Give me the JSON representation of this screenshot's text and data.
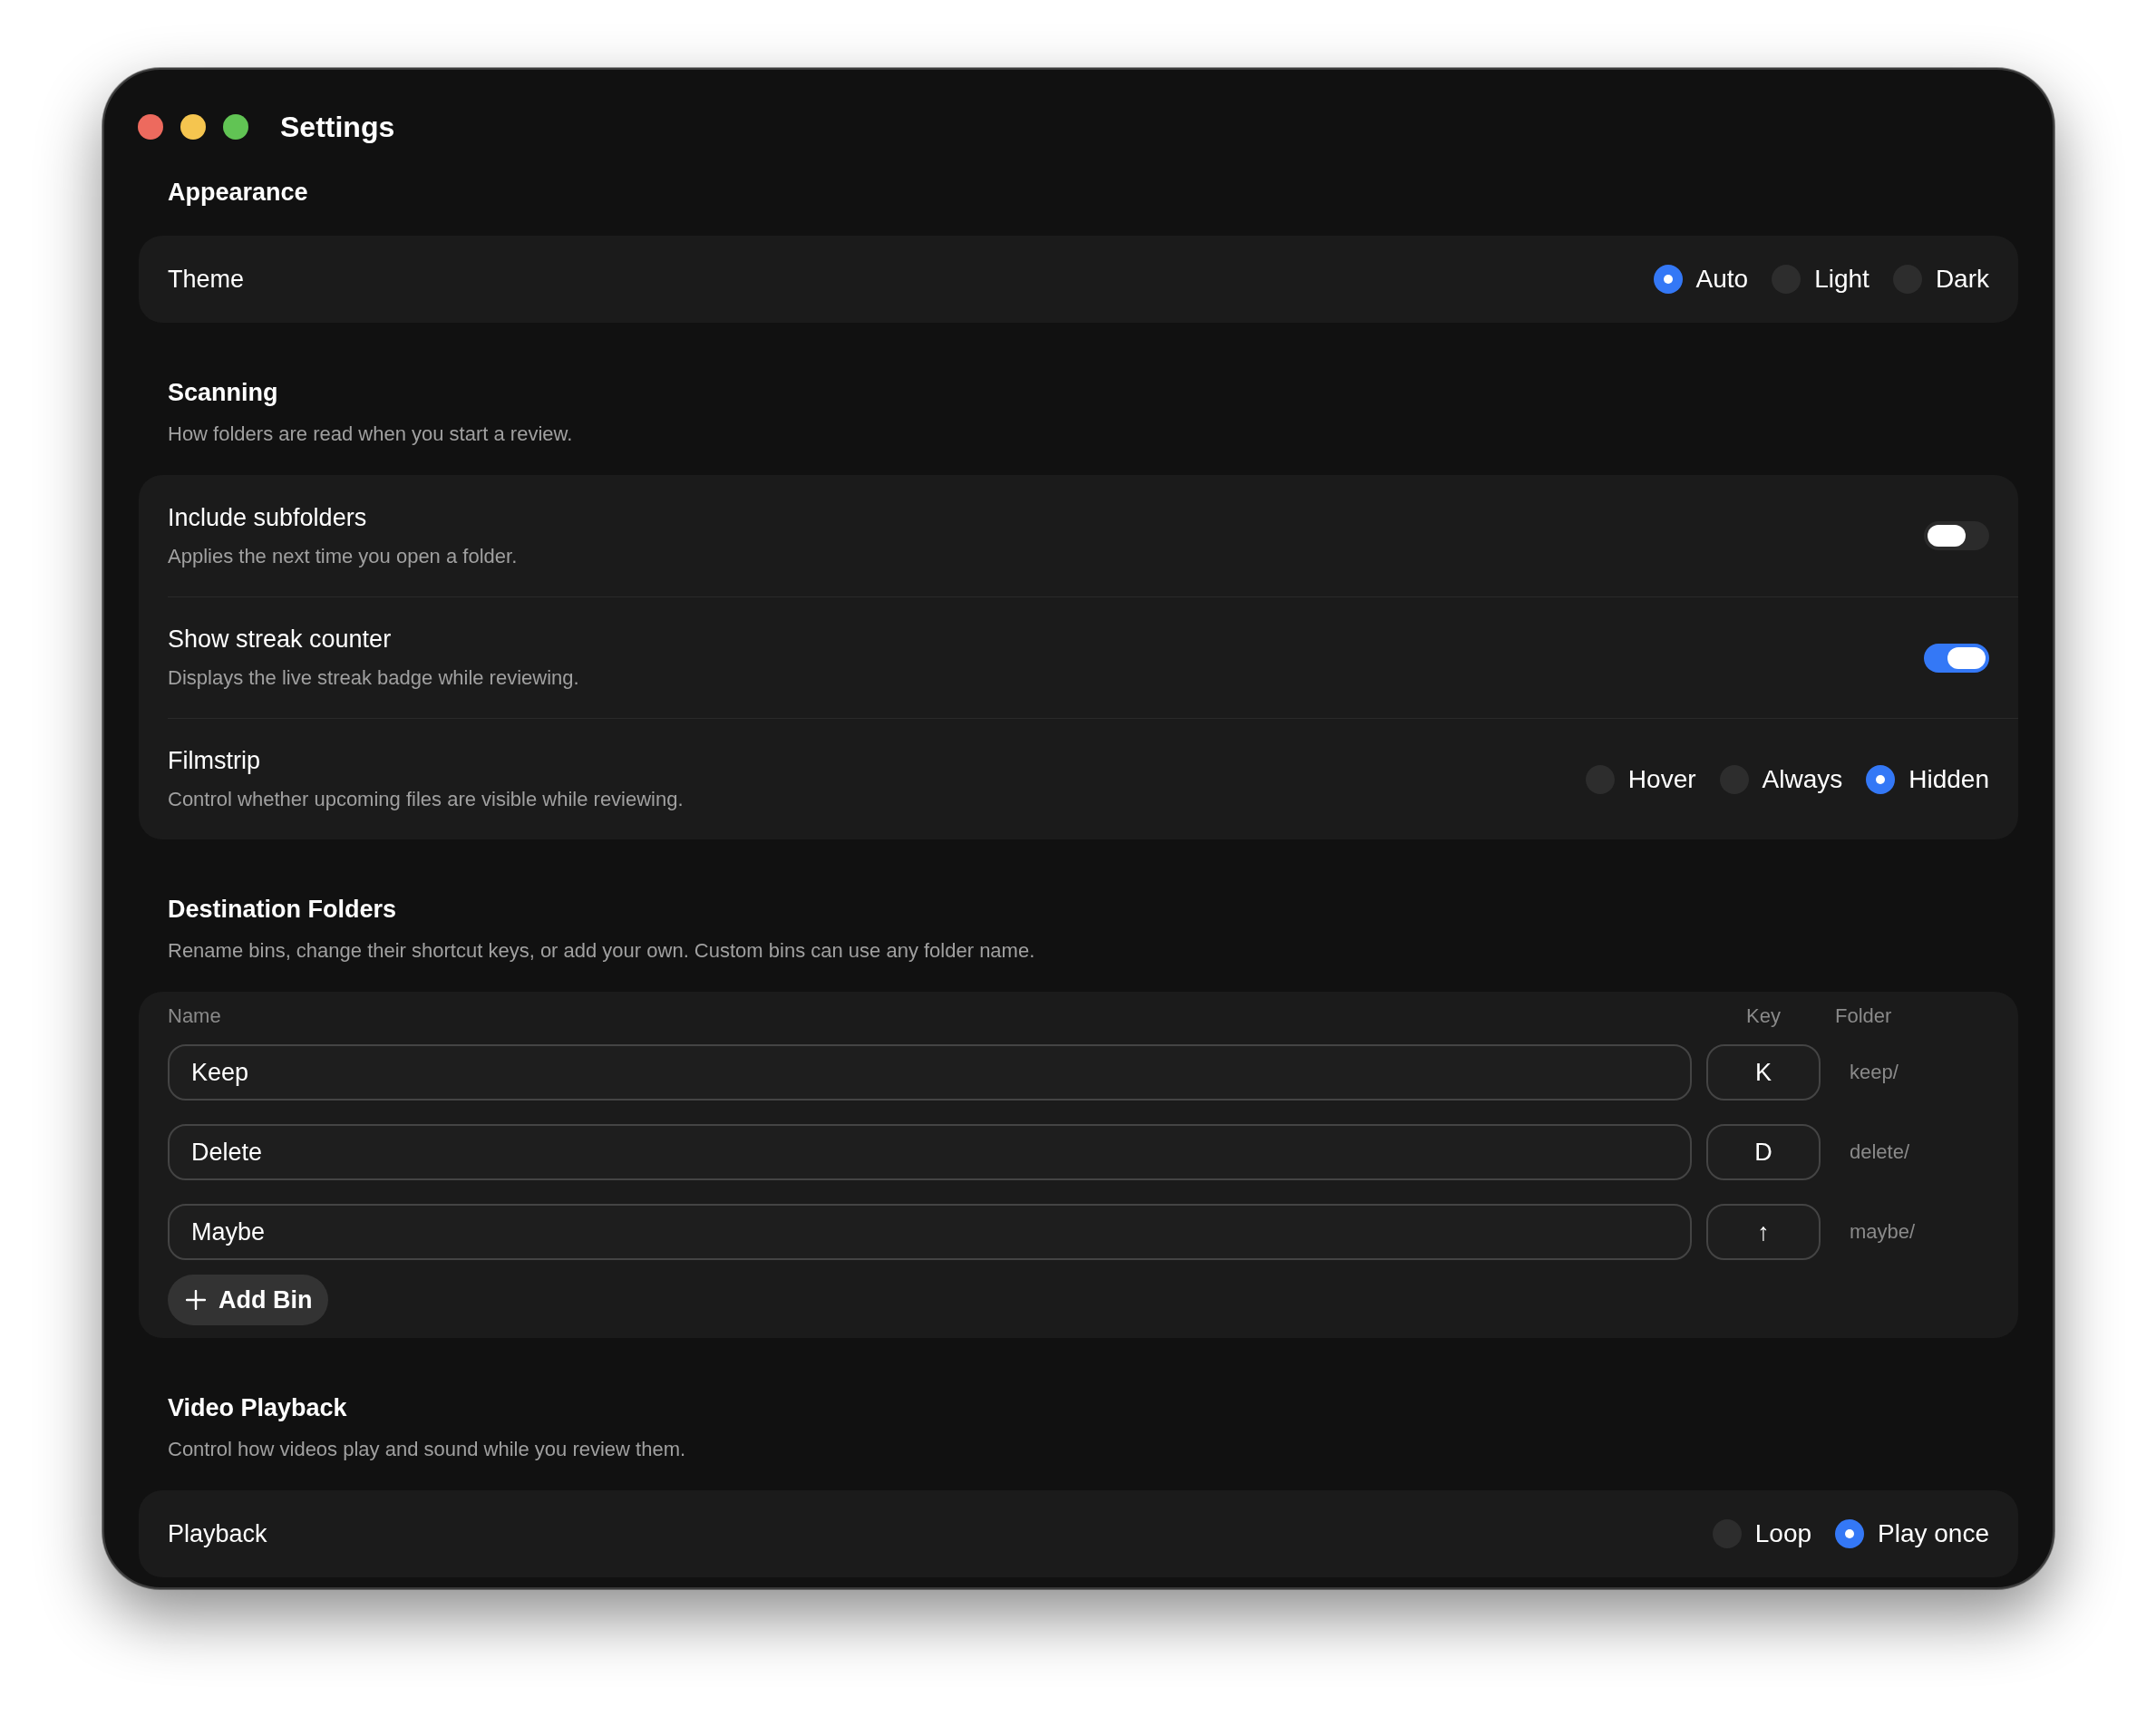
{
  "window": {
    "title": "Settings"
  },
  "sections": [
    {
      "heading": "Appearance",
      "card": {
        "kind": "rows",
        "rows": [
          {
            "kind": "radio",
            "label": "Theme",
            "options": [
              {
                "label": "Auto",
                "selected": true
              },
              {
                "label": "Light",
                "selected": false
              },
              {
                "label": "Dark",
                "selected": false
              }
            ]
          }
        ]
      }
    },
    {
      "heading": "Scanning",
      "description": "How folders are read when you start a review.",
      "card": {
        "kind": "rows",
        "rows": [
          {
            "kind": "toggle",
            "label": "Include subfolders",
            "description": "Applies the next time you open a folder.",
            "on": false
          },
          {
            "kind": "toggle",
            "label": "Show streak counter",
            "description": "Displays the live streak badge while reviewing.",
            "on": true
          },
          {
            "kind": "radio",
            "label": "Filmstrip",
            "description": "Control whether upcoming files are visible while reviewing.",
            "options": [
              {
                "label": "Hover",
                "selected": false
              },
              {
                "label": "Always",
                "selected": false
              },
              {
                "label": "Hidden",
                "selected": true
              }
            ]
          }
        ]
      }
    },
    {
      "heading": "Destination Folders",
      "description": "Rename bins, change their shortcut keys, or add your own. Custom bins can use any folder name.",
      "card": {
        "kind": "table",
        "columns": [
          "Name",
          "Key",
          "Folder"
        ],
        "rows": [
          {
            "name": "Keep",
            "key": "K",
            "folder": "keep/"
          },
          {
            "name": "Delete",
            "key": "D",
            "folder": "delete/"
          },
          {
            "name": "Maybe",
            "key": "↑",
            "folder": "maybe/"
          }
        ],
        "add_button": "Add Bin"
      }
    },
    {
      "heading": "Video Playback",
      "description": "Control how videos play and sound while you review them.",
      "card": {
        "kind": "rows",
        "rows": [
          {
            "kind": "radio",
            "label": "Playback",
            "options": [
              {
                "label": "Loop",
                "selected": false
              },
              {
                "label": "Play once",
                "selected": true
              }
            ]
          }
        ]
      }
    }
  ]
}
